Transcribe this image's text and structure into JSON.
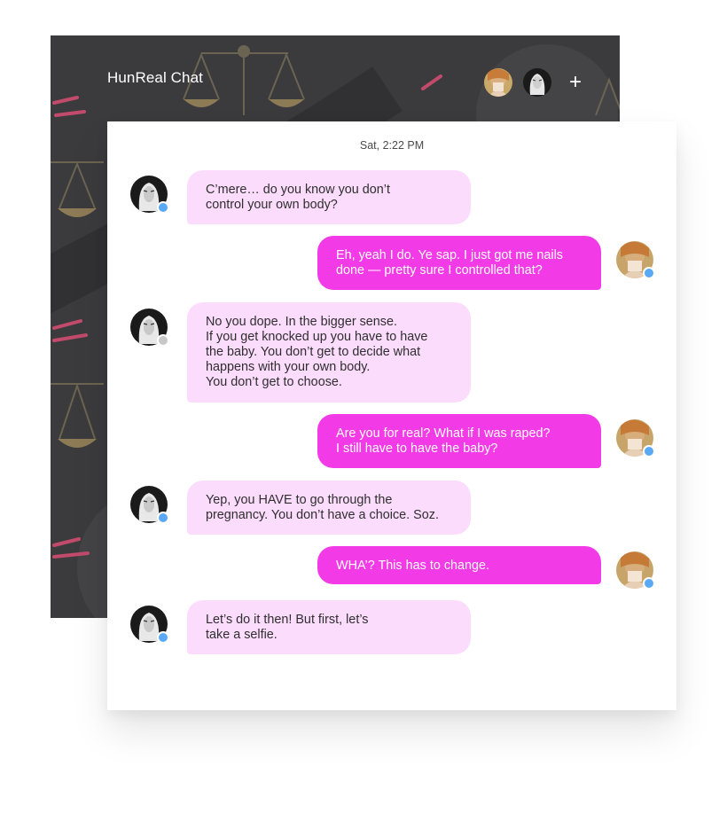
{
  "header": {
    "title": "HunReal Chat",
    "add_label": "+"
  },
  "chat": {
    "timestamp": "Sat, 2:22 PM",
    "messages": [
      {
        "from": "them",
        "status": "online",
        "text": "C’mere… do you know you don’t\ncontrol your own body?"
      },
      {
        "from": "me",
        "status": "online",
        "text": "Eh, yeah I do. Ye sap. I just got me nails\ndone — pretty sure I controlled that?"
      },
      {
        "from": "them",
        "status": "away",
        "text": "No you dope.  In the bigger sense.\nIf you get knocked up you have to have\nthe baby.  You don’t get to decide what\nhappens with your own body.\nYou don’t get to choose."
      },
      {
        "from": "me",
        "status": "online",
        "text": "Are you for real? What if I was raped?\nI still have to have the baby?"
      },
      {
        "from": "them",
        "status": "online",
        "text": "Yep, you HAVE to go through the\npregnancy. You don’t have a choice. Soz."
      },
      {
        "from": "me",
        "status": "online",
        "text": "WHA’? This has to change."
      },
      {
        "from": "them",
        "status": "online",
        "text": "Let’s do it then! But first, let’s\ntake a selfie."
      }
    ]
  },
  "colors": {
    "incoming_bubble": "#fcdcfc",
    "outgoing_bubble": "#f23ae6",
    "online_dot": "#5aa9f5",
    "away_dot": "#c8c8c8",
    "header_bg": "#3b3b3d"
  }
}
